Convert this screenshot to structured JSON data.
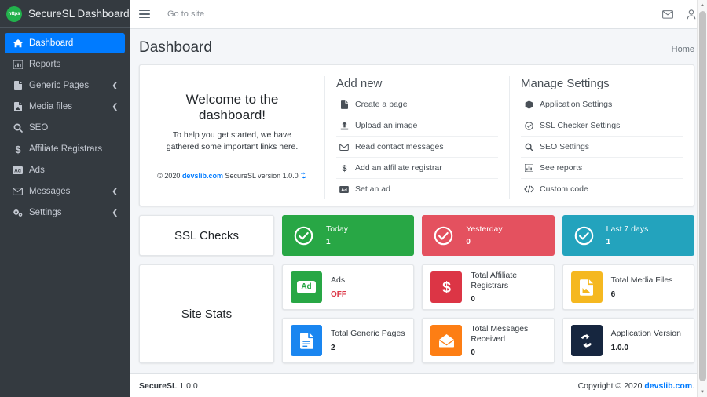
{
  "brand": {
    "logo_text": "https",
    "title": "SecureSL Dashboard"
  },
  "sidebar": {
    "items": [
      {
        "label": "Dashboard",
        "icon": "home-icon",
        "active": true,
        "caret": false
      },
      {
        "label": "Reports",
        "icon": "chart-bar-icon",
        "active": false,
        "caret": false
      },
      {
        "label": "Generic Pages",
        "icon": "file-icon",
        "active": false,
        "caret": true
      },
      {
        "label": "Media files",
        "icon": "file-image-icon",
        "active": false,
        "caret": true
      },
      {
        "label": "SEO",
        "icon": "search-icon",
        "active": false,
        "caret": false
      },
      {
        "label": "Affiliate Registrars",
        "icon": "dollar-icon",
        "active": false,
        "caret": false
      },
      {
        "label": "Ads",
        "icon": "ad-icon",
        "active": false,
        "caret": false
      },
      {
        "label": "Messages",
        "icon": "envelope-icon",
        "active": false,
        "caret": true
      },
      {
        "label": "Settings",
        "icon": "gears-icon",
        "active": false,
        "caret": true
      }
    ]
  },
  "topbar": {
    "menu_toggle": "hamburger-icon",
    "site_link": "Go to site",
    "mail_icon": "envelope-icon",
    "user_icon": "user-icon"
  },
  "page": {
    "title": "Dashboard",
    "breadcrumb": "Home"
  },
  "welcome": {
    "heading": "Welcome to the dashboard!",
    "body": "To help you get started, we have gathered some important links here.",
    "copyright_prefix": "© 2020 ",
    "copyright_link": "devslib.com",
    "version_text": "  SecureSL version 1.0.0",
    "sync_icon": "sync-icon"
  },
  "add_new": {
    "heading": "Add new",
    "links": [
      {
        "label": "Create a page",
        "icon": "file-icon"
      },
      {
        "label": "Upload an image",
        "icon": "upload-icon"
      },
      {
        "label": "Read contact messages",
        "icon": "envelope-icon"
      },
      {
        "label": "Add an affiliate registrar",
        "icon": "dollar-icon"
      },
      {
        "label": "Set an ad",
        "icon": "ad-icon"
      }
    ]
  },
  "manage_settings": {
    "heading": "Manage Settings",
    "links": [
      {
        "label": "Application Settings",
        "icon": "cube-icon"
      },
      {
        "label": "SSL Checker Settings",
        "icon": "check-circle-icon"
      },
      {
        "label": "SEO Settings",
        "icon": "search-icon"
      },
      {
        "label": "See reports",
        "icon": "chart-bar-icon"
      },
      {
        "label": "Custom code",
        "icon": "code-icon"
      }
    ]
  },
  "ssl_checks": {
    "panel_label": "SSL Checks",
    "tiles": [
      {
        "label": "Today",
        "value": "1",
        "color": "#28a745",
        "icon": "check-circle-icon"
      },
      {
        "label": "Yesterday",
        "value": "0",
        "color": "#e4515f",
        "icon": "check-circle-icon"
      },
      {
        "label": "Last 7 days",
        "value": "1",
        "color": "#23a3bd",
        "icon": "check-circle-icon"
      }
    ]
  },
  "site_stats": {
    "panel_label": "Site Stats",
    "tiles_row1": [
      {
        "label": "Ads",
        "value": "OFF",
        "value_style": "off",
        "color": "#28a745",
        "icon": "ad-icon"
      },
      {
        "label": "Total Affiliate Registrars",
        "value": "0",
        "color": "#dc3545",
        "icon": "dollar-icon"
      },
      {
        "label": "Total Media Files",
        "value": "6",
        "color": "#f5b820",
        "icon": "file-image-icon"
      }
    ],
    "tiles_row2": [
      {
        "label": "Total Generic Pages",
        "value": "2",
        "color": "#1a86f0",
        "icon": "file-icon"
      },
      {
        "label": "Total Messages Received",
        "value": "0",
        "color": "#fd7e14",
        "icon": "envelope-icon"
      },
      {
        "label": "Application Version",
        "value": "1.0.0",
        "color": "#16263f",
        "icon": "sync-icon"
      }
    ]
  },
  "footer": {
    "left_strong": "SecureSL",
    "left_version": " 1.0.0",
    "right_text": "Copyright © 2020 ",
    "right_link": "devslib.com",
    "right_suffix": "."
  }
}
